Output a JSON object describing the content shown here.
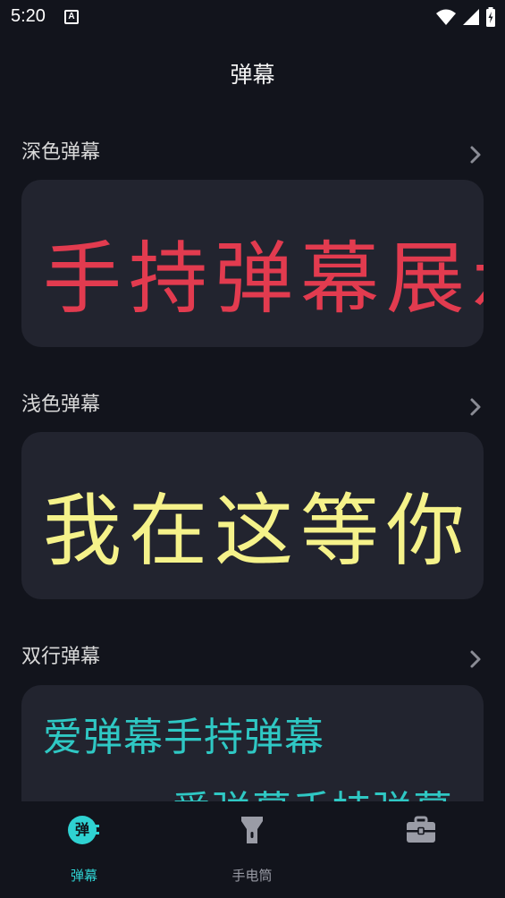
{
  "status_bar": {
    "time": "5:20",
    "notification_glyph": "A",
    "icons": [
      "wifi-icon",
      "cellular-icon",
      "battery-charging-icon"
    ]
  },
  "header": {
    "title": "弹幕"
  },
  "sections": [
    {
      "label": "深色弹幕",
      "preview_text": "手持弹幕展示",
      "text_color": "#e23b4f"
    },
    {
      "label": "浅色弹幕",
      "preview_text": "我在这等你",
      "text_color": "#f5f28a"
    },
    {
      "label": "双行弹幕",
      "line1": "爱弹幕手持弹幕",
      "line2": "爱弹幕手持弹幕",
      "text_color": "#2fc8c4"
    }
  ],
  "bottom_nav": {
    "items": [
      {
        "label": "弹幕",
        "badge": "弹",
        "icon": "danmu-icon",
        "active": true
      },
      {
        "label": "手电筒",
        "icon": "flashlight-icon",
        "active": false
      },
      {
        "label": "",
        "icon": "toolbox-icon",
        "active": false
      }
    ]
  },
  "colors": {
    "background": "#12141c",
    "card": "#22242f",
    "accent": "#2fd2d2"
  }
}
